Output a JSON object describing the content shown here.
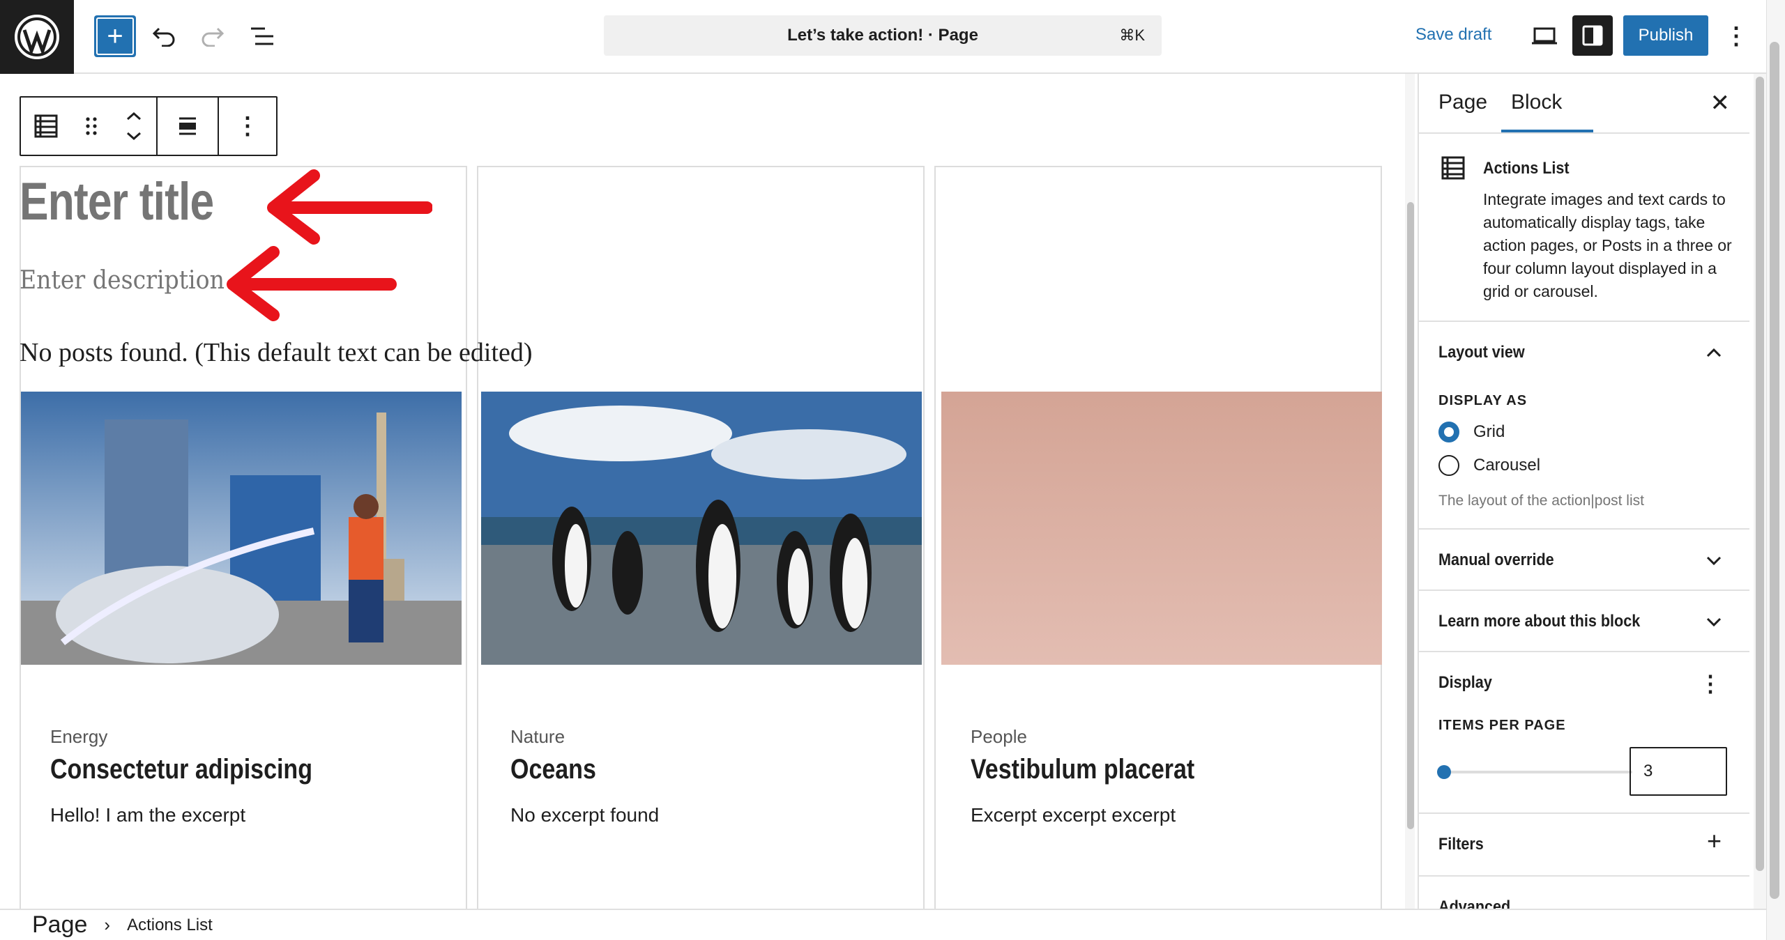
{
  "topbar": {
    "document_title": "Let’s take action! · Page",
    "shortcut": "⌘K",
    "save_draft_label": "Save draft",
    "publish_label": "Publish"
  },
  "canvas": {
    "title_placeholder": "Enter title",
    "description_placeholder": "Enter description",
    "no_posts_text": "No posts found. (This default text can be edited)",
    "cards": [
      {
        "tag": "Energy",
        "title": "Consectetur adipiscing",
        "excerpt": "Hello! I am the excerpt"
      },
      {
        "tag": "Nature",
        "title": "Oceans",
        "excerpt": "No excerpt found"
      },
      {
        "tag": "People",
        "title": "Vestibulum placerat",
        "excerpt": "Excerpt excerpt excerpt"
      }
    ]
  },
  "sidebar": {
    "tabs": [
      {
        "label": "Page"
      },
      {
        "label": "Block"
      }
    ],
    "active_tab": "Block",
    "block": {
      "name": "Actions List",
      "description": "Integrate images and text cards to automatically display tags, take action pages, or Posts in a three or four column layout displayed in a grid or carousel."
    },
    "panels": {
      "layout_view": {
        "title": "Layout view",
        "display_as_label": "DISPLAY AS",
        "options": [
          "Grid",
          "Carousel"
        ],
        "selected": "Grid",
        "help": "The layout of the action|post list"
      },
      "manual_override": {
        "title": "Manual override"
      },
      "learn_more": {
        "title": "Learn more about this block"
      },
      "display": {
        "title": "Display",
        "items_per_page_label": "ITEMS PER PAGE",
        "items_per_page_value": "3",
        "items_per_page_slider_fraction": 0.0
      },
      "filters": {
        "title": "Filters"
      },
      "advanced": {
        "title": "Advanced"
      }
    }
  },
  "footer": {
    "breadcrumb": [
      "Page",
      "Actions List"
    ]
  },
  "colors": {
    "accent": "#2271b1",
    "annotation_arrow": "#e8141b",
    "dark": "#1e1e1e"
  }
}
